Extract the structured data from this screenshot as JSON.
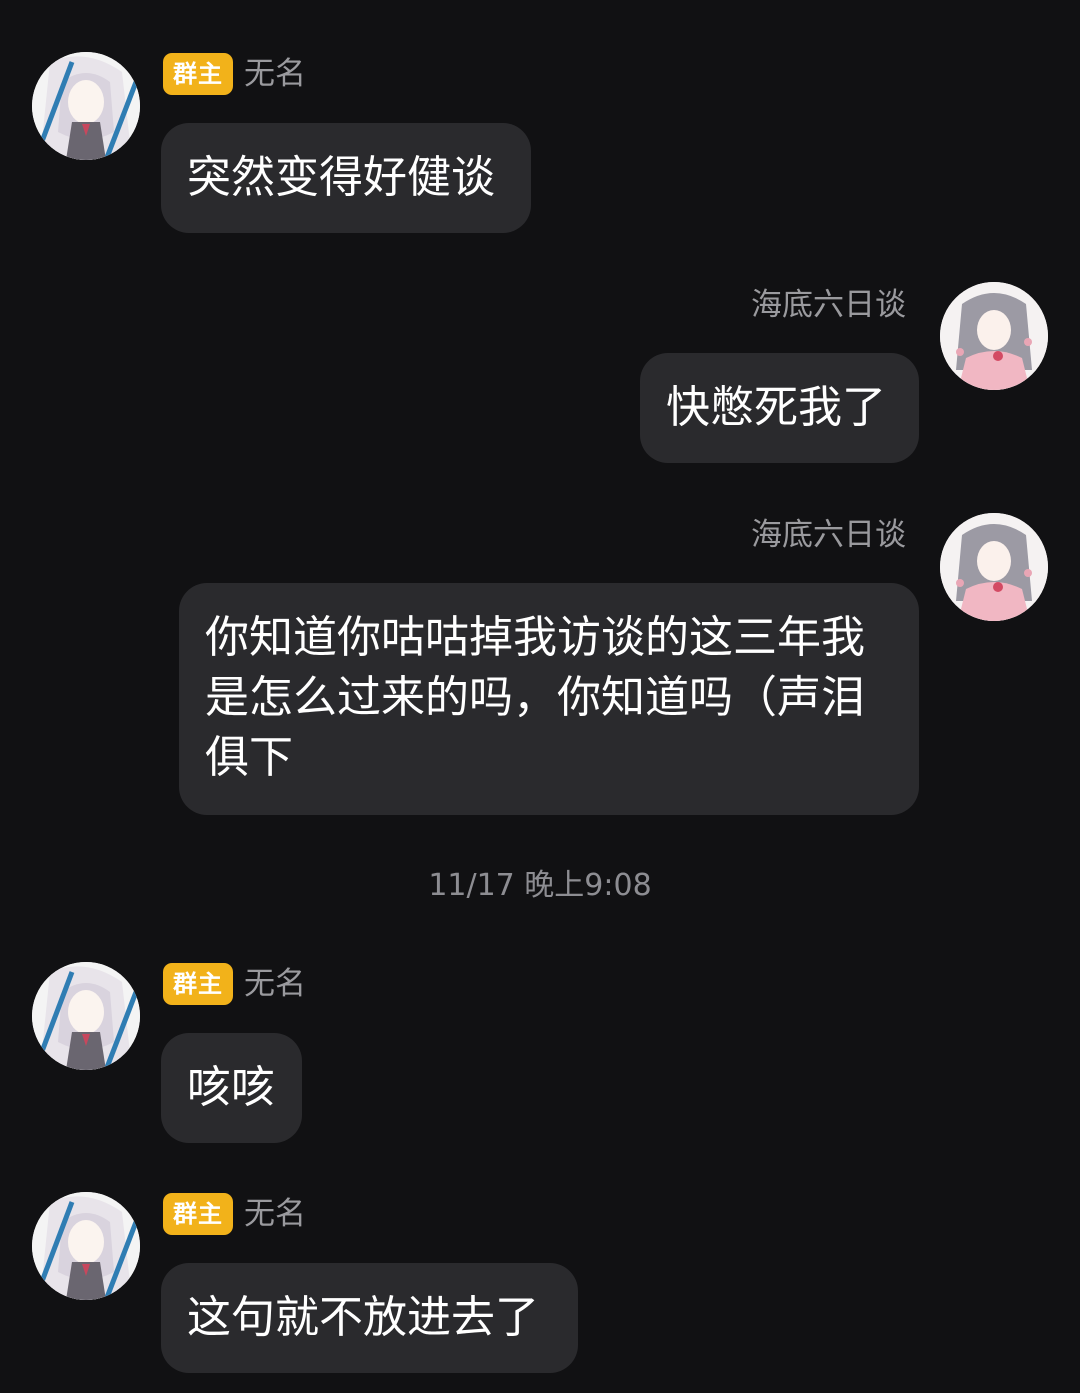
{
  "messages": [
    {
      "sender": "无名",
      "badge": "群主",
      "text": "突然变得好健谈",
      "side": "left"
    },
    {
      "sender": "海底六日谈",
      "text": "快憋死我了",
      "side": "right"
    },
    {
      "sender": "海底六日谈",
      "text": "你知道你咕咕掉我访谈的这三年我是怎么过来的吗，你知道吗（声泪俱下",
      "side": "right"
    },
    {
      "sender": "无名",
      "badge": "群主",
      "text": "咳咳",
      "side": "left"
    },
    {
      "sender": "无名",
      "badge": "群主",
      "text": "这句就不放进去了",
      "side": "left"
    }
  ],
  "timestamp": "11/17 晚上9:08",
  "colors": {
    "background": "#111113",
    "bubble": "#2a2a2d",
    "badge": "#f2b21a",
    "sender_text": "#9a9a9e"
  }
}
